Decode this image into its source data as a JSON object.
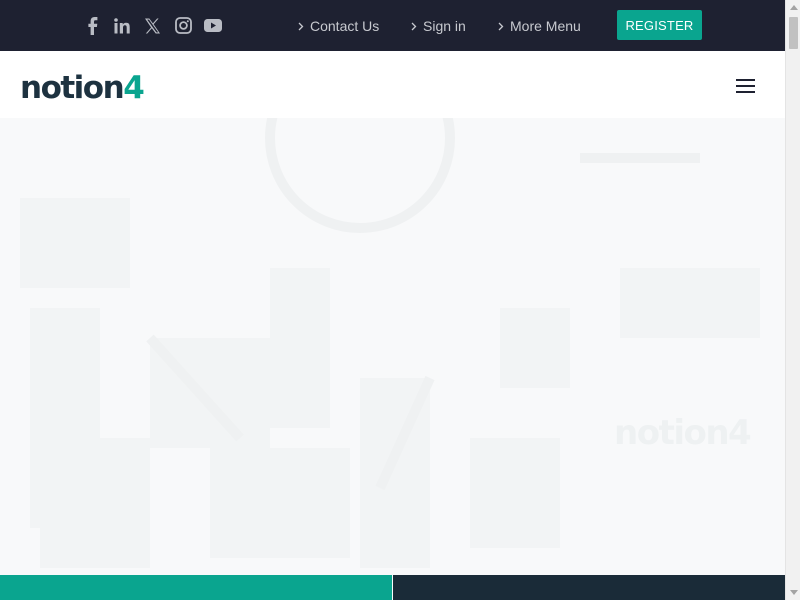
{
  "topbar": {
    "social": [
      {
        "name": "facebook-icon"
      },
      {
        "name": "linkedin-icon"
      },
      {
        "name": "x-twitter-icon"
      },
      {
        "name": "instagram-icon"
      },
      {
        "name": "youtube-icon"
      }
    ],
    "links": [
      {
        "label": "Contact Us"
      },
      {
        "label": "Sign in"
      },
      {
        "label": "More Menu"
      }
    ],
    "register_label": "REGISTER"
  },
  "header": {
    "logo_text": "notion",
    "logo_suffix": "4",
    "menu_icon": "hamburger-menu-icon"
  },
  "hero": {
    "watermark_text": "notion",
    "watermark_suffix": "4"
  },
  "colors": {
    "topbar_bg": "#1e2131",
    "accent": "#0aa58f",
    "logo_dark": "#1d3240",
    "panel_dark": "#1a2b38"
  }
}
